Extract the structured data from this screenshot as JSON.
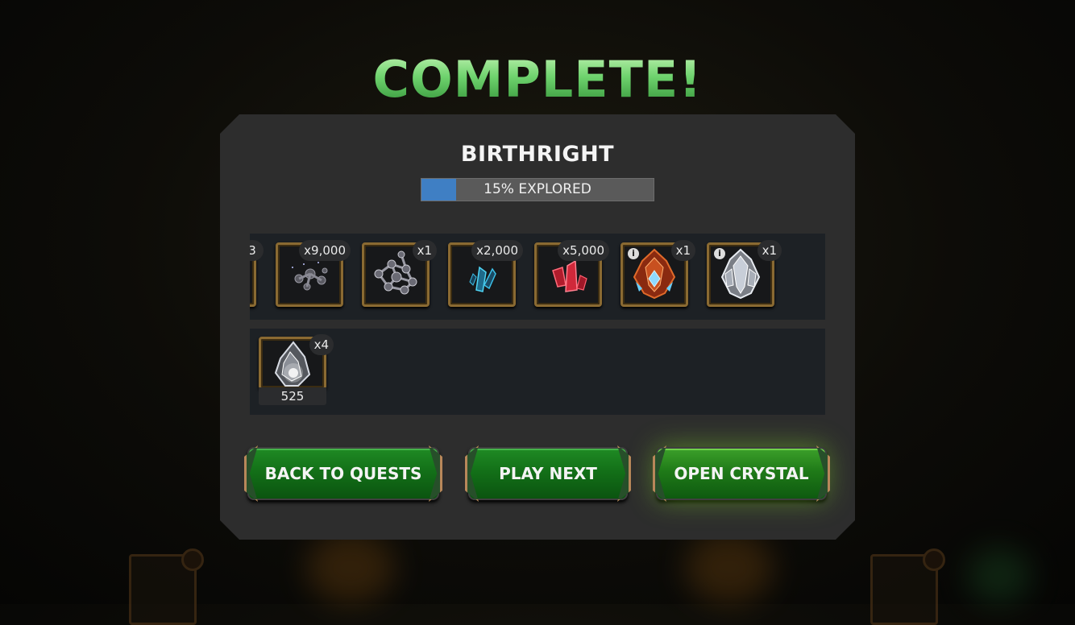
{
  "title": "COMPLETE!",
  "quest": {
    "name": "BIRTHRIGHT",
    "progress_text": "15% EXPLORED",
    "progress_fraction": 0.15
  },
  "rewards_row1": [
    {
      "icon": "item-partial-icon",
      "count": "3"
    },
    {
      "icon": "iso8-shards-icon",
      "count": "x9,000"
    },
    {
      "icon": "iso8-catalyst-icon",
      "count": "x1"
    },
    {
      "icon": "blue-shards-icon",
      "count": "x2,000"
    },
    {
      "icon": "red-shards-icon",
      "count": "x5,000"
    },
    {
      "icon": "premium-crystal-icon",
      "count": "x1",
      "info": "i"
    },
    {
      "icon": "silver-crystal-icon",
      "count": "x1",
      "info": "i"
    }
  ],
  "rewards_row2": [
    {
      "icon": "energy-shard-icon",
      "count": "x4",
      "value": "525"
    }
  ],
  "buttons": {
    "back": "BACK TO QUESTS",
    "play_next": "PLAY NEXT",
    "open_crystal": "OPEN CRYSTAL"
  },
  "colors": {
    "title_green": "#7fe08a",
    "progress_blue": "#3f7fc4",
    "button_green": "#137018",
    "frame_gold": "#8a6a32"
  }
}
